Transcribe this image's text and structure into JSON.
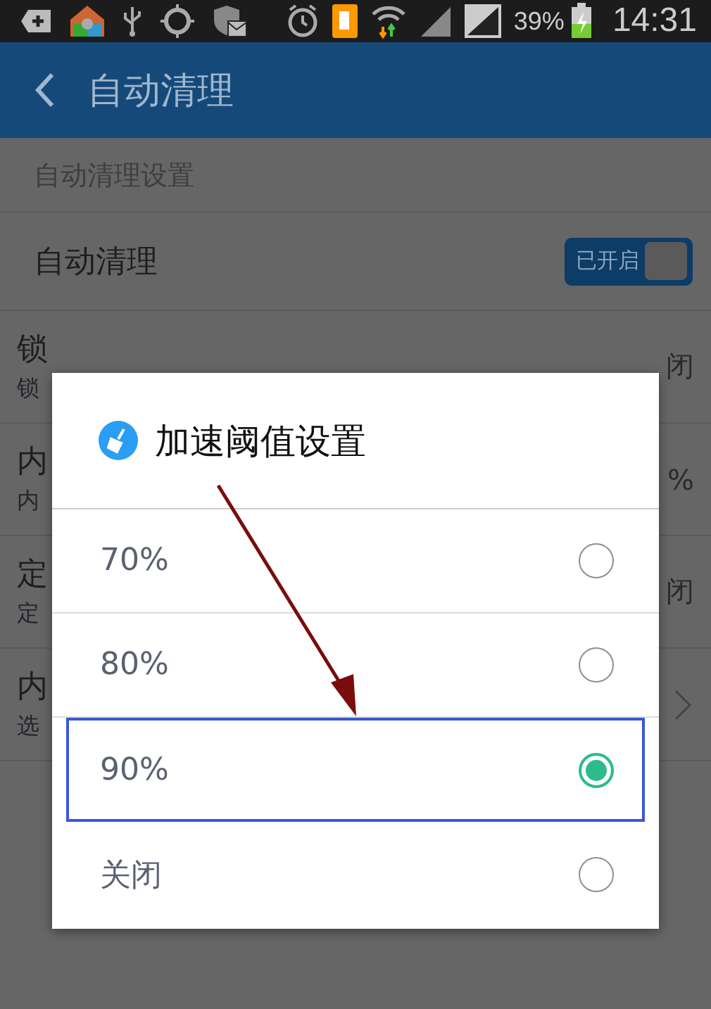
{
  "status_bar": {
    "battery_percent": "39%",
    "time": "14:31"
  },
  "header": {
    "title": "自动清理"
  },
  "section_label": "自动清理设置",
  "auto_clean": {
    "label": "自动清理",
    "toggle_text": "已开启",
    "on": true
  },
  "rows": [
    {
      "kind": "value",
      "title": "锁",
      "subtitle": "锁",
      "value": "闭"
    },
    {
      "kind": "value",
      "title": "内",
      "subtitle": "内",
      "value": "%"
    },
    {
      "kind": "value",
      "title": "定",
      "subtitle": "定",
      "value": "闭"
    },
    {
      "kind": "chevron",
      "title": "内",
      "subtitle": "选"
    }
  ],
  "dialog": {
    "title": "加速阈值设置",
    "options": [
      {
        "label": "70%",
        "selected": false
      },
      {
        "label": "80%",
        "selected": false
      },
      {
        "label": "90%",
        "selected": true
      },
      {
        "label": "关闭",
        "selected": false
      }
    ]
  }
}
